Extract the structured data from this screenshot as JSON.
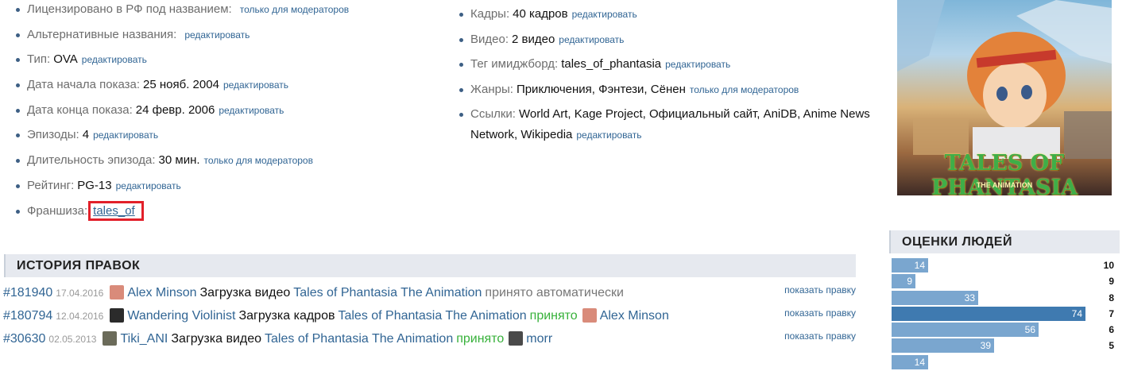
{
  "details_left": [
    {
      "key": "Лицензировано в РФ под названием:",
      "value": "",
      "action": "только для модераторов",
      "action_gap": true
    },
    {
      "key": "Альтернативные названия:",
      "value": "",
      "action": "редактировать",
      "action_gap": true
    },
    {
      "key": "Тип:",
      "value": "OVA",
      "action": "редактировать"
    },
    {
      "key": "Дата начала показа:",
      "value": "25 нояб. 2004",
      "action": "редактировать"
    },
    {
      "key": "Дата конца показа:",
      "value": "24 февр. 2006",
      "action": "редактировать"
    },
    {
      "key": "Эпизоды:",
      "value": "4",
      "action": "редактировать"
    },
    {
      "key": "Длительность эпизода:",
      "value": "30 мин.",
      "action": "только для модераторов"
    },
    {
      "key": "Рейтинг:",
      "value": "PG-13",
      "action": "редактировать"
    }
  ],
  "franchise": {
    "key": "Франшиза:",
    "value": "tales_of"
  },
  "details_right": [
    {
      "key": "Кадры:",
      "value": "40 кадров",
      "action": "редактировать"
    },
    {
      "key": "Видео:",
      "value": "2 видео",
      "action": "редактировать"
    },
    {
      "key": "Тег имиджборд:",
      "value": "tales_of_phantasia",
      "action": "редактировать"
    },
    {
      "key": "Жанры:",
      "value": "Приключения, Фэнтези, Сёнен",
      "action": "только для модераторов"
    },
    {
      "key": "Ссылки:",
      "value": "World Art, Kage Project, Официальный сайт, AniDB, Anime News Network, Wikipedia",
      "action": "редактировать"
    }
  ],
  "poster": {
    "logo": "TALES OF PHANTASIA",
    "subtitle": "THE ANIMATION"
  },
  "history": {
    "title": "ИСТОРИЯ ПРАВОК",
    "show_label": "показать правку",
    "rows": [
      {
        "id": "#181940",
        "date": "17.04.2016",
        "user": "Alex Minson",
        "user_color": "#d98b7a",
        "action": "Загрузка видео",
        "anime": "Tales of Phantasia The Animation",
        "status": "принято автоматически",
        "status_kind": "auto",
        "approver": "",
        "approver_color": ""
      },
      {
        "id": "#180794",
        "date": "12.04.2016",
        "user": "Wandering Violinist",
        "user_color": "#2b2b2b",
        "action": "Загрузка кадров",
        "anime": "Tales of Phantasia The Animation",
        "status": "принято",
        "status_kind": "ok",
        "approver": "Alex Minson",
        "approver_color": "#d98b7a"
      },
      {
        "id": "#30630",
        "date": "02.05.2013",
        "user": "Tiki_ANI",
        "user_color": "#6b6b5a",
        "action": "Загрузка видео",
        "anime": "Tales of Phantasia The Animation",
        "status": "принято",
        "status_kind": "ok",
        "approver": "morr",
        "approver_color": "#4a4a4a"
      }
    ]
  },
  "ratings": {
    "title": "ОЦЕНКИ ЛЮДЕЙ",
    "max": 74,
    "rows": [
      {
        "score": "10",
        "count": 14
      },
      {
        "score": "9",
        "count": 9
      },
      {
        "score": "8",
        "count": 33
      },
      {
        "score": "7",
        "count": 74
      },
      {
        "score": "6",
        "count": 56
      },
      {
        "score": "5",
        "count": 39
      },
      {
        "score": "",
        "count": 14
      }
    ]
  }
}
